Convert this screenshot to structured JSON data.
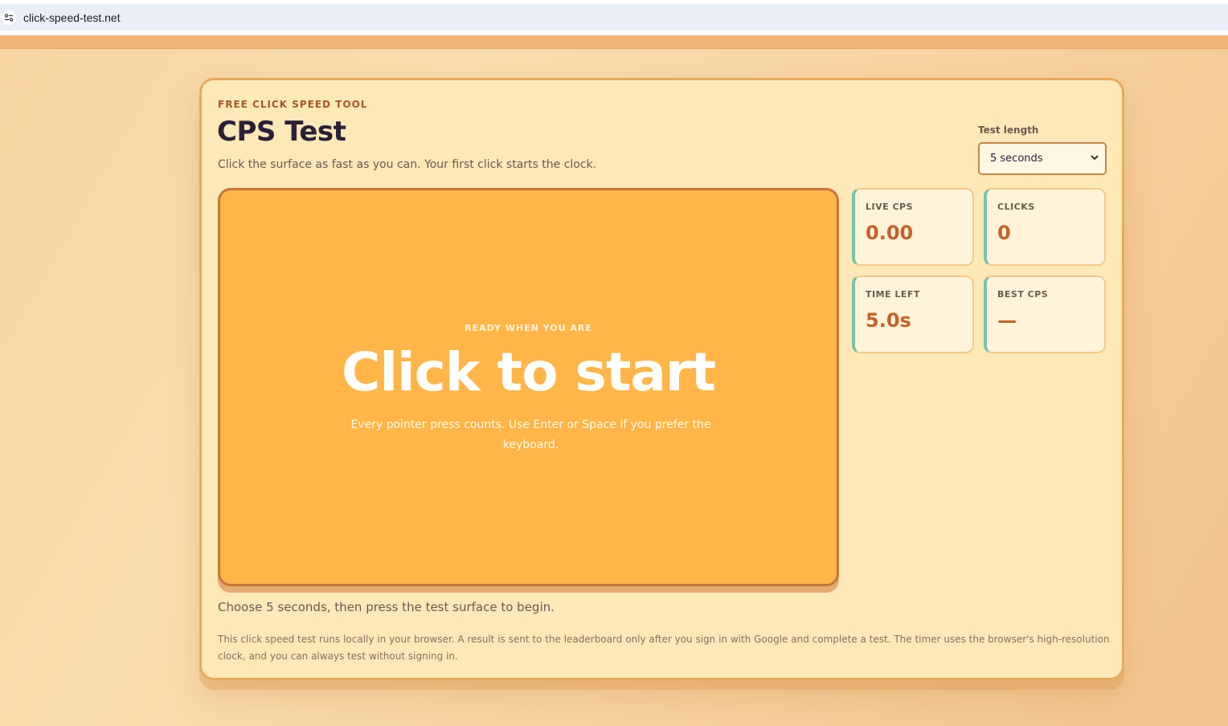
{
  "browser": {
    "url": "click-speed-test.net"
  },
  "header": {
    "eyebrow": "FREE CLICK SPEED TOOL",
    "title": "CPS Test",
    "subtitle": "Click the surface as fast as you can. Your first click starts the clock."
  },
  "test_length": {
    "label": "Test length",
    "selected": "5 seconds"
  },
  "surface": {
    "eyebrow": "READY WHEN YOU ARE",
    "headline": "Click to start",
    "hint": "Every pointer press counts. Use Enter or Space if you prefer the keyboard."
  },
  "stats": [
    {
      "label": "LIVE CPS",
      "value": "0.00"
    },
    {
      "label": "CLICKS",
      "value": "0"
    },
    {
      "label": "TIME LEFT",
      "value": "5.0s"
    },
    {
      "label": "BEST CPS",
      "value": "—"
    }
  ],
  "status": "Choose 5 seconds, then press the test surface to begin.",
  "footnote": "This click speed test runs locally in your browser. A result is sent to the leaderboard only after you sign in with Google and complete a test. The timer uses the browser's high-resolution clock, and you can always test without signing in.",
  "colors": {
    "accent": "#ffb547",
    "title": "#2b2037",
    "stat_value": "#c4622a",
    "stat_border": "#79c2a6"
  }
}
